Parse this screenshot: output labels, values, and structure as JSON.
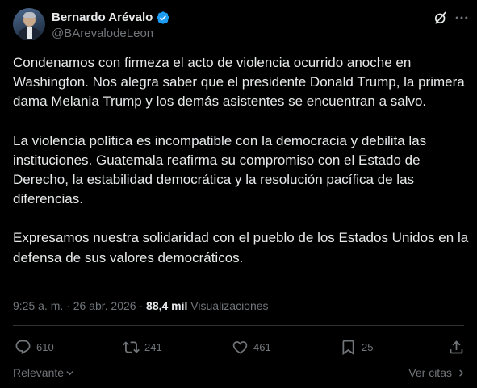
{
  "author": {
    "display_name": "Bernardo Arévalo",
    "handle": "@BArevalodeLeon",
    "verified": true
  },
  "tweet": {
    "paragraphs": [
      "Condenamos con firmeza el acto de violencia ocurrido anoche en Washington. Nos alegra saber que el presidente Donald Trump, la primera dama Melania Trump y los demás asistentes se encuentran a salvo.",
      "La violencia política es incompatible con la democracia y debilita las instituciones. Guatemala reafirma su compromiso con el Estado de Derecho, la estabilidad democrática y la resolución pacífica de las diferencias.",
      "Expresamos nuestra solidaridad con el pueblo de los Estados Unidos en la defensa de sus valores democráticos."
    ],
    "time": "9:25 a. m.",
    "separator": "·",
    "date": "26 abr. 2026",
    "views_count": "88,4 mil",
    "views_label": "Visualizaciones"
  },
  "actions": {
    "replies": "610",
    "reposts": "241",
    "likes": "461",
    "bookmarks": "25"
  },
  "footer": {
    "sort_label": "Relevante",
    "quotes_label": "Ver citas"
  },
  "colors": {
    "background": "#000000",
    "text_primary": "#e7e9ea",
    "text_secondary": "#71767b",
    "verified_badge": "#1d9bf0",
    "divider": "#2f3336"
  },
  "icons": [
    "verified-badge-icon",
    "grok-icon",
    "more-icon",
    "reply-icon",
    "repost-icon",
    "like-icon",
    "bookmark-icon",
    "share-icon",
    "chevron-down-icon",
    "chevron-right-icon"
  ]
}
